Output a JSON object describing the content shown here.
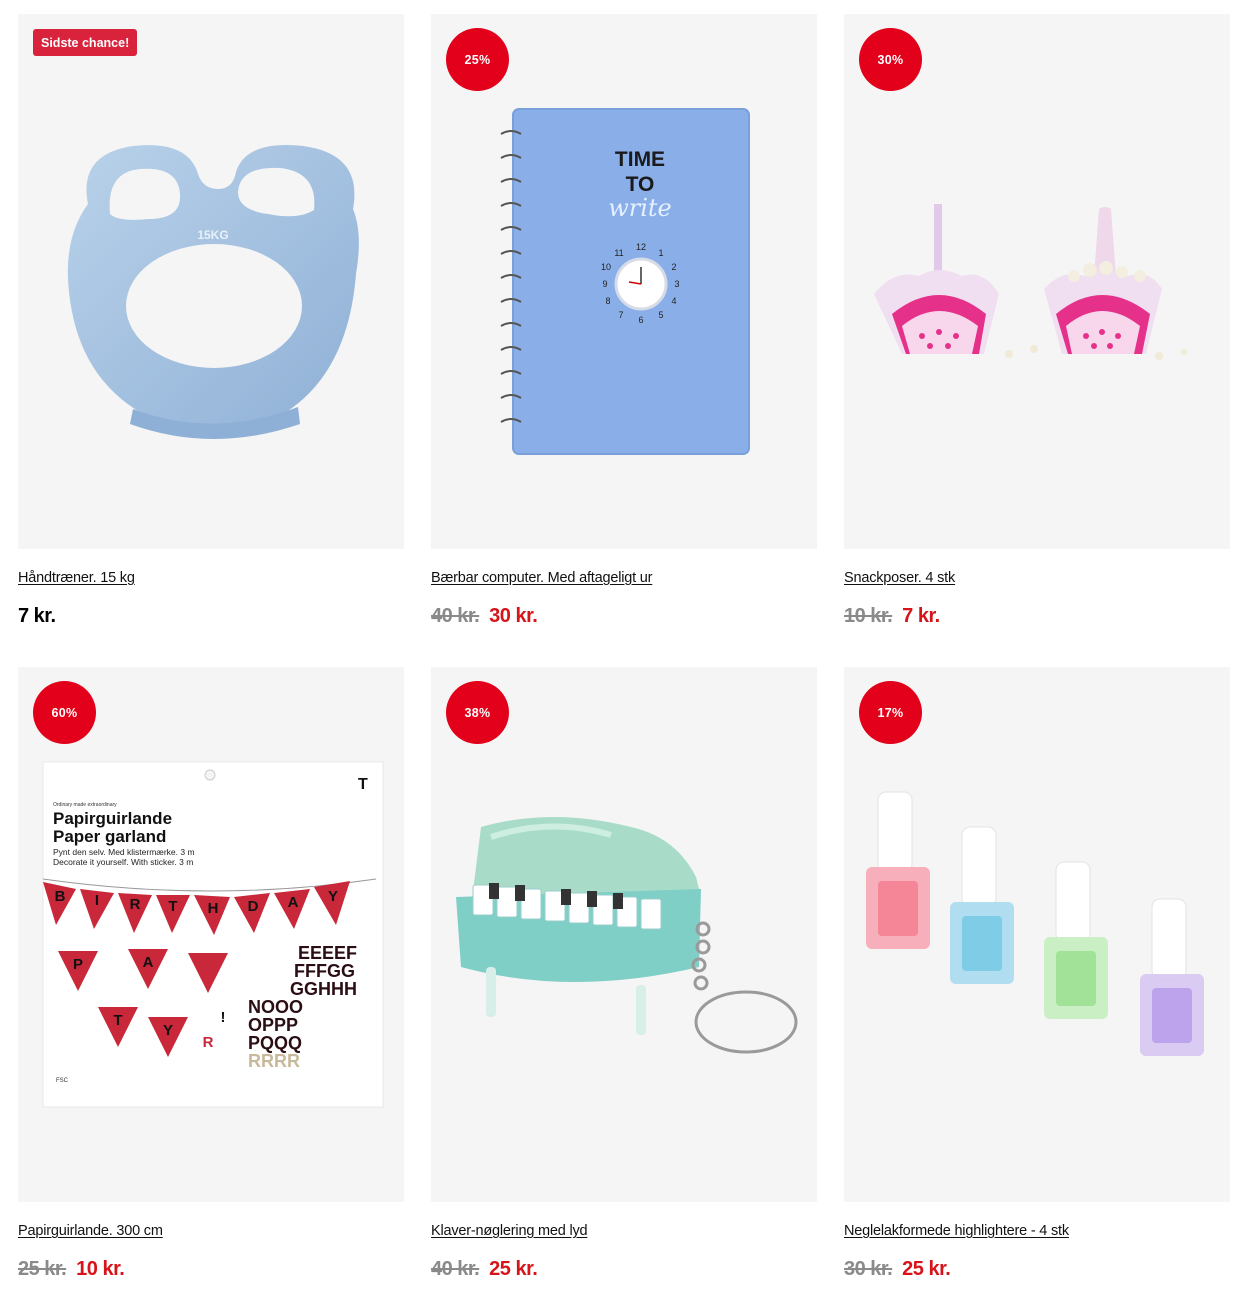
{
  "products": [
    {
      "badge": "Sidste chance!",
      "badge_type": "rect",
      "title": "Håndtræner. 15 kg",
      "price_old": "",
      "price_now": "7 kr.",
      "image": "hand-grip-trainer",
      "image_text": "15KG"
    },
    {
      "badge": "25%",
      "badge_type": "round",
      "title": "Bærbar computer. Med aftageligt ur",
      "price_old": "40 kr.",
      "price_now": "30 kr.",
      "image": "notebook-with-clock",
      "image_text": [
        "TIME",
        "TO",
        "write"
      ],
      "clock_numbers": [
        "12",
        "1",
        "2",
        "3",
        "4",
        "5",
        "6",
        "7",
        "8",
        "9",
        "10",
        "11"
      ]
    },
    {
      "badge": "30%",
      "badge_type": "round",
      "title": "Snackposer. 4 stk",
      "price_old": "10 kr.",
      "price_now": "7 kr.",
      "image": "snack-bags"
    },
    {
      "badge": "60%",
      "badge_type": "round",
      "title": "Papirguirlande. 300 cm",
      "price_old": "25 kr.",
      "price_now": "10 kr.",
      "image": "paper-garland",
      "image_text": {
        "small": "Ordinary made extraordinary",
        "line1": "Papirguirlande",
        "line2": "Paper garland",
        "line3": "Pynt den selv. Med klistermærke. 3 m",
        "line4": "Decorate it yourself. With sticker. 3 m",
        "flags": [
          "B",
          "I",
          "R",
          "T",
          "H",
          "D",
          "A",
          "Y",
          "P",
          "A",
          "R",
          "T",
          "Y",
          "!",
          "R"
        ],
        "stickers": [
          "EEEEF",
          "FFFGG",
          "GGHHH",
          "NOOO",
          "OPPP",
          "PQQQ",
          "RRRR"
        ],
        "fsc": "FSC"
      }
    },
    {
      "badge": "38%",
      "badge_type": "round",
      "title": "Klaver-nøglering med lyd",
      "price_old": "40 kr.",
      "price_now": "25 kr.",
      "image": "piano-keychain"
    },
    {
      "badge": "17%",
      "badge_type": "round",
      "title": "Neglelakformede highlightere - 4 stk",
      "price_old": "30 kr.",
      "price_now": "25 kr.",
      "image": "nail-polish-highlighters"
    }
  ],
  "colors": {
    "badge_red": "#e2001a",
    "price_red": "#d7141a",
    "old_price_grey": "#8a8a8a",
    "card_bg": "#f5f5f5"
  }
}
